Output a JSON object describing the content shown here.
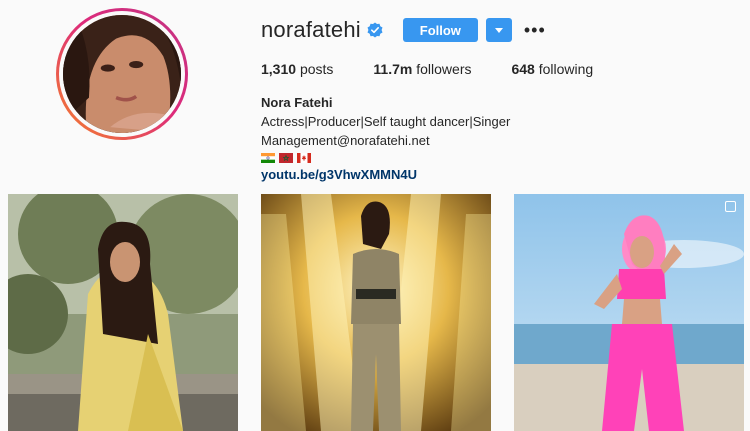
{
  "profile": {
    "username": "norafatehi",
    "follow_label": "Follow",
    "more_icon": "more-dots-icon",
    "verified_icon": "verified-badge-icon"
  },
  "stats": {
    "posts_count": "1,310",
    "posts_label": "posts",
    "followers_count": "11.7m",
    "followers_label": "followers",
    "following_count": "648",
    "following_label": "following"
  },
  "bio": {
    "name": "Nora Fatehi",
    "line1": "Actress|Producer|Self taught dancer|Singer",
    "line2": "Management@norafatehi.net",
    "flags": [
      "india-flag",
      "morocco-flag",
      "canada-flag"
    ],
    "link": "youtu.be/g3VhwXMMN4U"
  },
  "colors": {
    "accent": "#3897f0",
    "link": "#003569",
    "avatar_ring_start": "#f58529",
    "avatar_ring_end": "#c13584"
  },
  "posts": [
    {
      "description": "woman-in-yellow-saree-outdoors"
    },
    {
      "description": "woman-in-camo-outfit-on-stage-lights"
    },
    {
      "description": "woman-with-pink-hair-pink-ruffle-outfit-beach"
    }
  ]
}
